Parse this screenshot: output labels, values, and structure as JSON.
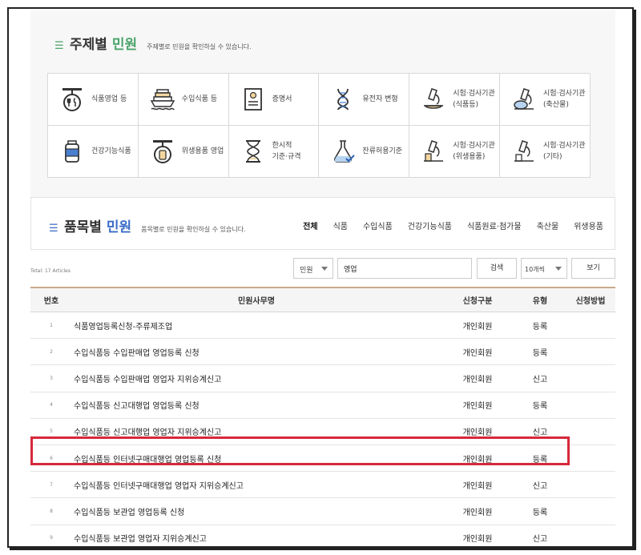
{
  "topic_section": {
    "title_prefix": "주제별",
    "title_accent": "민원",
    "subtitle": "주제별로 민원을 확인하실 수 있습니다.",
    "items": [
      {
        "label": "식품영업 등",
        "icon": "food-business-icon"
      },
      {
        "label": "수입식품 등",
        "icon": "import-ship-icon"
      },
      {
        "label": "증명서",
        "icon": "certificate-icon"
      },
      {
        "label": "유전자 변형",
        "icon": "dna-icon"
      },
      {
        "label": "시험·검사기관\n(식품등)",
        "icon": "microscope-food-icon"
      },
      {
        "label": "시험·검사기관\n(축산물)",
        "icon": "microscope-livestock-icon"
      },
      {
        "label": "건강기능식품",
        "icon": "supplement-bottle-icon"
      },
      {
        "label": "위생용품 영업",
        "icon": "hygiene-product-icon"
      },
      {
        "label": "한시적\n기준·규격",
        "icon": "hourglass-icon"
      },
      {
        "label": "잔류허용기준",
        "icon": "flask-check-icon"
      },
      {
        "label": "시험·검사기관\n(위생용품)",
        "icon": "microscope-hygiene-icon"
      },
      {
        "label": "시험·검사기관\n(기타)",
        "icon": "microscope-other-icon"
      }
    ]
  },
  "item_section": {
    "title_prefix": "품목별",
    "title_accent": "민원",
    "subtitle": "품목별로 민원을 확인하실 수 있습니다.",
    "nav": [
      "전체",
      "식품",
      "수입식품",
      "건강기능식품",
      "식품원료·첨가물",
      "축산물",
      "위생용품"
    ]
  },
  "search": {
    "total": "Total: 17 Articles",
    "category": "민원",
    "query": "영업",
    "search_label": "검색",
    "per_page": "10개씩",
    "view_label": "보기"
  },
  "table": {
    "headers": [
      "번호",
      "민원사무명",
      "신청구분",
      "유형",
      "신청방법"
    ],
    "rows": [
      {
        "num": "1",
        "name": "식품영업등록신청-주류제조업",
        "apply": "개인회원",
        "type": "등록",
        "method": ""
      },
      {
        "num": "2",
        "name": "수입식품등 수입판매업 영업등록 신청",
        "apply": "개인회원",
        "type": "등록",
        "method": ""
      },
      {
        "num": "3",
        "name": "수입식품등 수입판매업 영업자 지위승계신고",
        "apply": "개인회원",
        "type": "신고",
        "method": ""
      },
      {
        "num": "4",
        "name": "수입식품등 신고대행업 영업등록 신청",
        "apply": "개인회원",
        "type": "등록",
        "method": ""
      },
      {
        "num": "5",
        "name": "수입식품등 신고대행업 영업자 지위승계신고",
        "apply": "개인회원",
        "type": "신고",
        "method": ""
      },
      {
        "num": "6",
        "name": "수입식품등 인터넷구매대행업 영업등록 신청",
        "apply": "개인회원",
        "type": "등록",
        "method": ""
      },
      {
        "num": "7",
        "name": "수입식품등 인터넷구매대행업 영업자 지위승계신고",
        "apply": "개인회원",
        "type": "신고",
        "method": ""
      },
      {
        "num": "8",
        "name": "수입식품등 보관업 영업등록 신청",
        "apply": "개인회원",
        "type": "등록",
        "method": ""
      },
      {
        "num": "9",
        "name": "수입식품등 보관업 영업자 지위승계신고",
        "apply": "개인회원",
        "type": "신고",
        "method": ""
      }
    ]
  },
  "colors": {
    "accent_green": "#4aa36a",
    "accent_blue": "#3a6cc8",
    "highlight_red": "#d6293a"
  }
}
